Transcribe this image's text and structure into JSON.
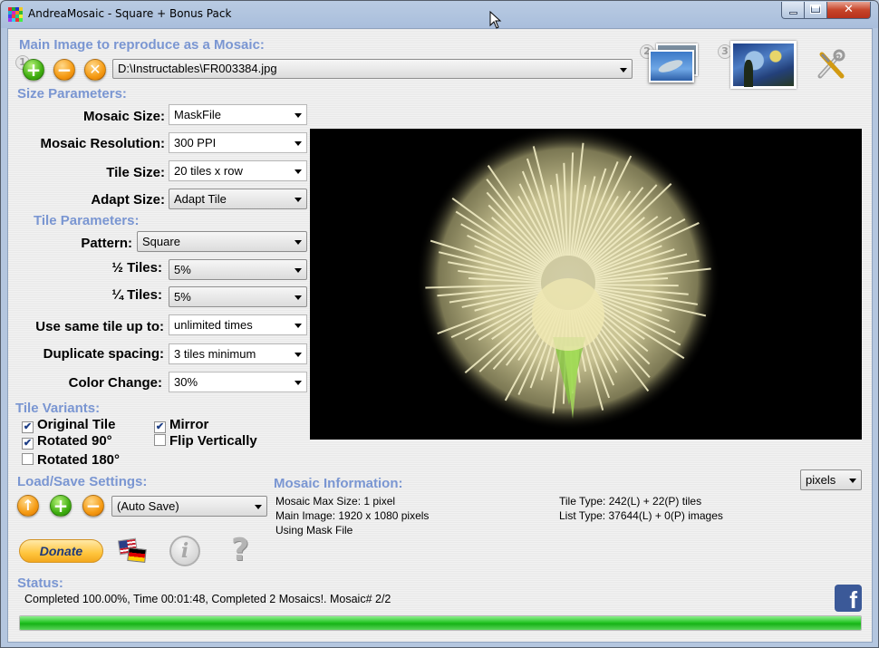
{
  "window": {
    "title": "AndreaMosaic - Square + Bonus Pack"
  },
  "main_image": {
    "title": "Main Image to reproduce as a Mosaic:",
    "path": "D:\\Instructables\\FR003384.jpg",
    "badges": [
      "1",
      "2",
      "3"
    ]
  },
  "size_params": {
    "title": "Size Parameters:",
    "mosaic_size": {
      "label": "Mosaic Size:",
      "value": "MaskFile"
    },
    "mosaic_resolution": {
      "label": "Mosaic Resolution:",
      "value": "300 PPI"
    },
    "tile_size": {
      "label": "Tile Size:",
      "value": "20 tiles x row"
    },
    "adapt_size": {
      "label": "Adapt Size:",
      "value": "Adapt Tile"
    }
  },
  "tile_params": {
    "title": "Tile Parameters:",
    "pattern": {
      "label": "Pattern:",
      "value": "Square"
    },
    "half_tiles": {
      "label": "½ Tiles:",
      "value": "5%"
    },
    "quarter_tiles": {
      "label": "¼ Tiles:",
      "value": "5%"
    },
    "same_tile": {
      "label": "Use same tile up to:",
      "value": "unlimited times"
    },
    "duplicate_spacing": {
      "label": "Duplicate spacing:",
      "value": "3 tiles minimum"
    },
    "color_change": {
      "label": "Color Change:",
      "value": "30%"
    }
  },
  "variants": {
    "title": "Tile Variants:",
    "original": {
      "label": "Original Tile",
      "checked": true
    },
    "mirror": {
      "label": "Mirror",
      "checked": true
    },
    "rot90": {
      "label": "Rotated 90°",
      "checked": true
    },
    "flipv": {
      "label": "Flip Vertically",
      "checked": false
    },
    "rot180": {
      "label": "Rotated 180°",
      "checked": false
    }
  },
  "load_save": {
    "title": "Load/Save Settings:",
    "value": "(Auto Save)"
  },
  "donate_label": "Donate",
  "mosaic_info": {
    "title": "Mosaic Information:",
    "unit": "pixels",
    "max_size": "Mosaic Max Size: 1 pixel",
    "main_image": "Main Image: 1920 x 1080 pixels",
    "mask": "Using Mask File",
    "tile_type": "Tile Type: 242(L) + 22(P) tiles",
    "list_type": "List Type: 37644(L) + 0(P) images"
  },
  "status": {
    "title": "Status:",
    "text": "Completed 100.00%, Time 00:01:48, Completed 2 Mosaics!. Mosaic# 2/2",
    "progress": 1.0
  },
  "colors": {
    "section": "#7a96d2",
    "progress": "#22c022",
    "facebook": "#3b5998"
  }
}
